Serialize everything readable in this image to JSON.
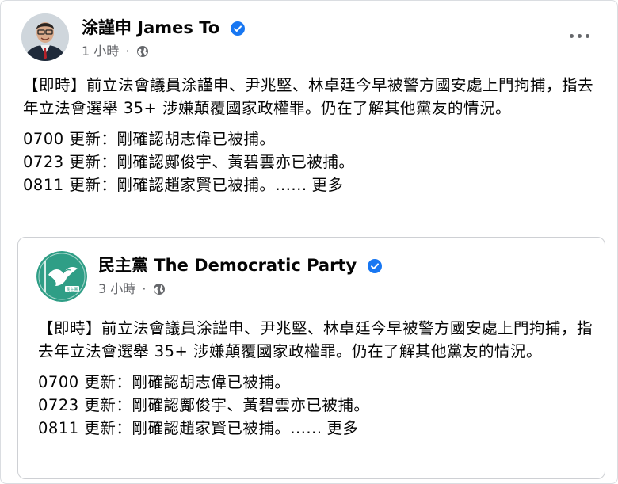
{
  "post": {
    "author": "涂謹申 James To",
    "time": "1 小時",
    "dot": "·",
    "paragraph": "【即時】前立法會議員涂謹申、尹兆堅、林卓廷今早被警方國安處上門拘捕，指去年立法會選舉 35+ 涉嫌顛覆國家政權罪。仍在了解其他黨友的情況。",
    "updates": [
      "0700 更新：剛確認胡志偉已被捕。",
      "0723 更新：剛確認鄺俊宇、黃碧雲亦已被捕。",
      "0811 更新：剛確認趙家賢已被捕。......"
    ],
    "see_more": "更多"
  },
  "shared_post": {
    "author": "民主黨 The Democratic Party",
    "time": "3 小時",
    "dot": "·",
    "logo_text": "民主黨",
    "paragraph": "【即時】前立法會議員涂謹申、尹兆堅、林卓廷今早被警方國安處上門拘捕，指去年立法會選舉 35+ 涉嫌顛覆國家政權罪。仍在了解其他黨友的情況。",
    "updates": [
      "0700 更新：剛確認胡志偉已被捕。",
      "0723 更新：剛確認鄺俊宇、黃碧雲亦已被捕。",
      "0811 更新：剛確認趙家賢已被捕。......"
    ],
    "see_more": "更多"
  },
  "icons": {
    "verified": "verified-badge-icon",
    "audience": "globe-icon",
    "menu": "more-horizontal-icon"
  },
  "colors": {
    "verified_blue": "#1877f2",
    "meta_gray": "#65676b",
    "border": "#dadde1",
    "dp_green": "#2f9e86"
  }
}
